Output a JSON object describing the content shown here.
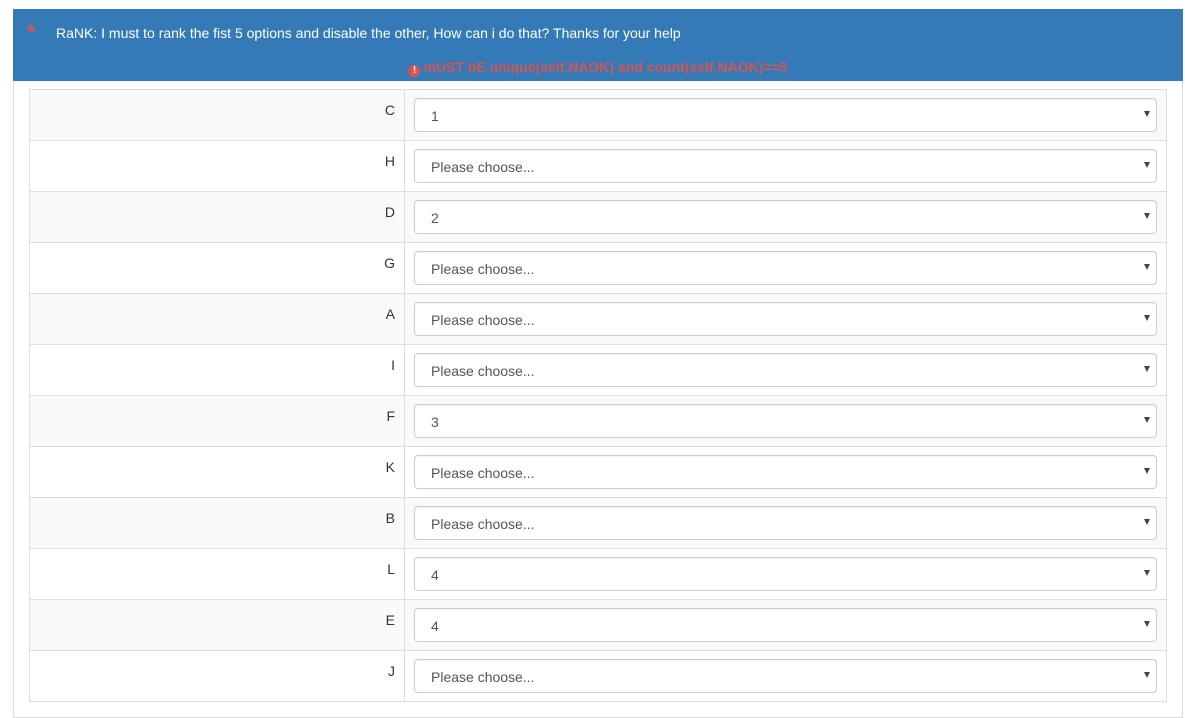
{
  "question": {
    "required_marker": "*",
    "text": "RaNK: I must to rank the fist 5 options and disable the other, How can i do that? Thanks for your help",
    "validation_message": "mUST bE unique(self.NAOK) and count(self.NAOK)==5",
    "validation_icon": "!"
  },
  "rows": [
    {
      "label": "C",
      "value": "1"
    },
    {
      "label": "H",
      "value": "Please choose..."
    },
    {
      "label": "D",
      "value": "2"
    },
    {
      "label": "G",
      "value": "Please choose..."
    },
    {
      "label": "A",
      "value": "Please choose..."
    },
    {
      "label": "I",
      "value": "Please choose..."
    },
    {
      "label": "F",
      "value": "3"
    },
    {
      "label": "K",
      "value": "Please choose..."
    },
    {
      "label": "B",
      "value": "Please choose..."
    },
    {
      "label": "L",
      "value": "4"
    },
    {
      "label": "E",
      "value": "4"
    },
    {
      "label": "J",
      "value": "Please choose..."
    }
  ],
  "colors": {
    "header_bg": "#337ab7",
    "error": "#d9534f",
    "stripe": "#f9f9f9"
  }
}
